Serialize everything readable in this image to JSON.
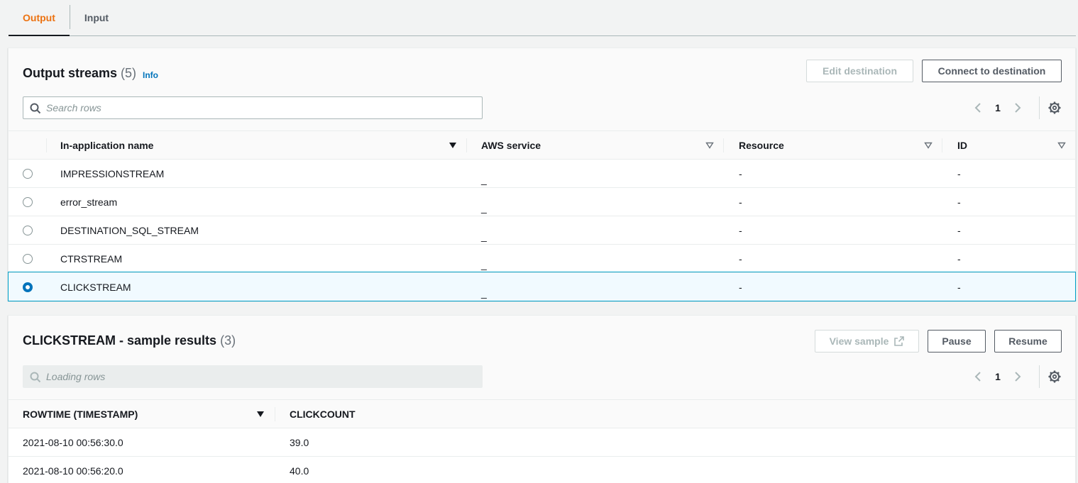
{
  "tabs": [
    {
      "label": "Output",
      "active": true
    },
    {
      "label": "Input",
      "active": false
    }
  ],
  "output_streams": {
    "title": "Output streams",
    "count": "(5)",
    "info_label": "Info",
    "edit_destination_label": "Edit destination",
    "connect_destination_label": "Connect to destination",
    "search_placeholder": "Search rows",
    "page": "1",
    "columns": [
      "In-application name",
      "AWS service",
      "Resource",
      "ID"
    ],
    "rows": [
      {
        "name": "IMPRESSIONSTREAM",
        "service": "_",
        "resource": "-",
        "id": "-",
        "selected": false
      },
      {
        "name": "error_stream",
        "service": "_",
        "resource": "-",
        "id": "-",
        "selected": false
      },
      {
        "name": "DESTINATION_SQL_STREAM",
        "service": "_",
        "resource": "-",
        "id": "-",
        "selected": false
      },
      {
        "name": "CTRSTREAM",
        "service": "_",
        "resource": "-",
        "id": "-",
        "selected": false
      },
      {
        "name": "CLICKSTREAM",
        "service": "_",
        "resource": "-",
        "id": "-",
        "selected": true
      }
    ]
  },
  "sample_results": {
    "title": "CLICKSTREAM - sample results",
    "count": "(3)",
    "view_sample_label": "View sample",
    "pause_label": "Pause",
    "resume_label": "Resume",
    "search_placeholder": "Loading rows",
    "page": "1",
    "columns": [
      "ROWTIME (TIMESTAMP)",
      "CLICKCOUNT"
    ],
    "rows": [
      {
        "rowtime": "2021-08-10 00:56:30.0",
        "clickcount": "39.0"
      },
      {
        "rowtime": "2021-08-10 00:56:20.0",
        "clickcount": "40.0"
      }
    ]
  },
  "colors": {
    "active_tab": "#ec7211",
    "link": "#0073bb",
    "selected_row_bg": "#f1faff",
    "selected_row_border": "#00a1c9"
  }
}
